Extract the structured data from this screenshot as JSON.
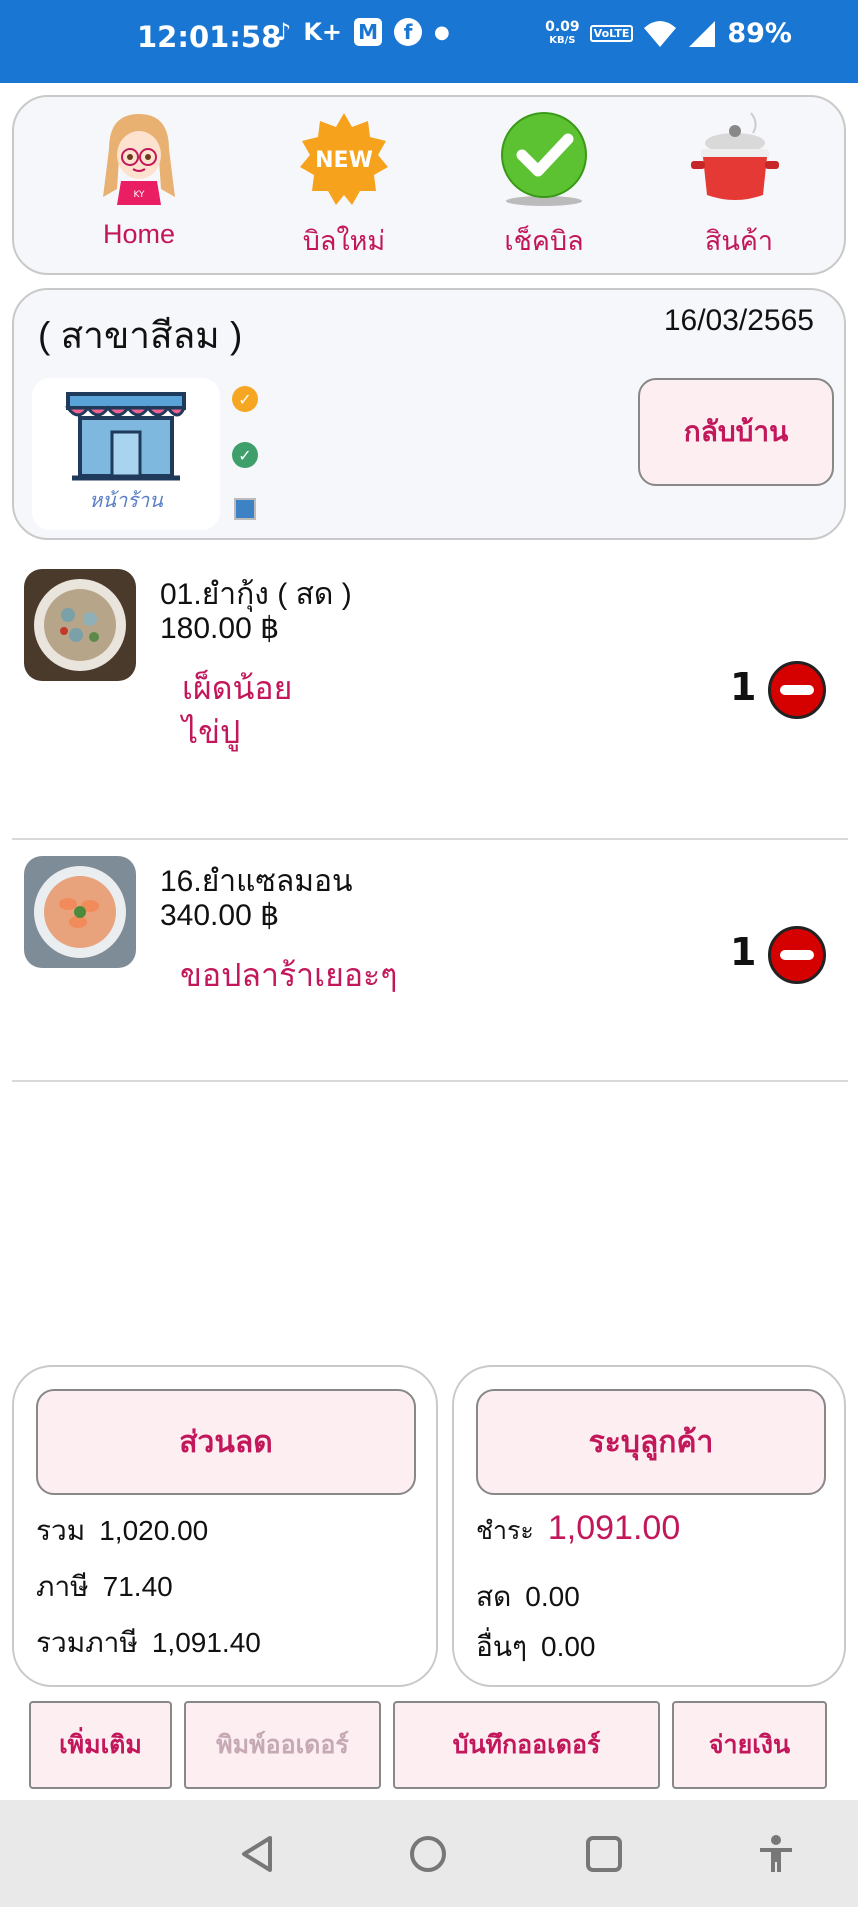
{
  "status_bar": {
    "time": "12:01:58",
    "icons": [
      "tiktok-icon",
      "k-plus-icon",
      "gmail-icon",
      "facebook-icon",
      "dot-icon"
    ],
    "speed_top": "0.09",
    "speed_bottom": "KB/S",
    "volte": "VoLTE",
    "battery": "89%"
  },
  "nav": {
    "items": [
      {
        "label": "Home",
        "icon": "girl-avatar-icon"
      },
      {
        "label": "บิลใหม่",
        "icon": "new-badge-icon"
      },
      {
        "label": "เช็คบิล",
        "icon": "green-check-icon"
      },
      {
        "label": "สินค้า",
        "icon": "cooking-pot-icon"
      }
    ]
  },
  "branch": {
    "name": "( สาขาสีลม )",
    "date": "16/03/2565",
    "shop_label": "หน้าร้าน",
    "home_button": "กลับบ้าน",
    "status_colors": [
      "#f5a623",
      "#3f9f6b",
      "#3d82c4"
    ]
  },
  "order_items": [
    {
      "name": "01.ยำกุ้ง ( สด )",
      "price": "180.00 ฿",
      "notes": [
        "เผ็ดน้อย",
        "ไข่ปู"
      ],
      "qty": "1"
    },
    {
      "name": "16.ยำแซลมอน",
      "price": "340.00 ฿",
      "notes": [
        "ขอปลาร้าเยอะๆ"
      ],
      "qty": "1"
    }
  ],
  "summary": {
    "discount_button": "ส่วนลด",
    "total_label": "รวม",
    "total_value": "1,020.00",
    "tax_label": "ภาษี",
    "tax_value": "71.40",
    "total_tax_label": "รวมภาษี",
    "total_tax_value": "1,091.40"
  },
  "payment": {
    "customer_button": "ระบุลูกค้า",
    "pay_label": "ชำระ",
    "pay_value": "1,091.00",
    "cash_label": "สด",
    "cash_value": "0.00",
    "other_label": "อื่นๆ",
    "other_value": "0.00"
  },
  "actions": {
    "more": "เพิ่มเติม",
    "print_order": "พิมพ์ออเดอร์",
    "save_order": "บันทึกออเดอร์",
    "pay": "จ่ายเงิน"
  },
  "colors": {
    "accent": "#c2185b",
    "status_bar": "#1976d2",
    "button_bg": "#fdeef2"
  }
}
